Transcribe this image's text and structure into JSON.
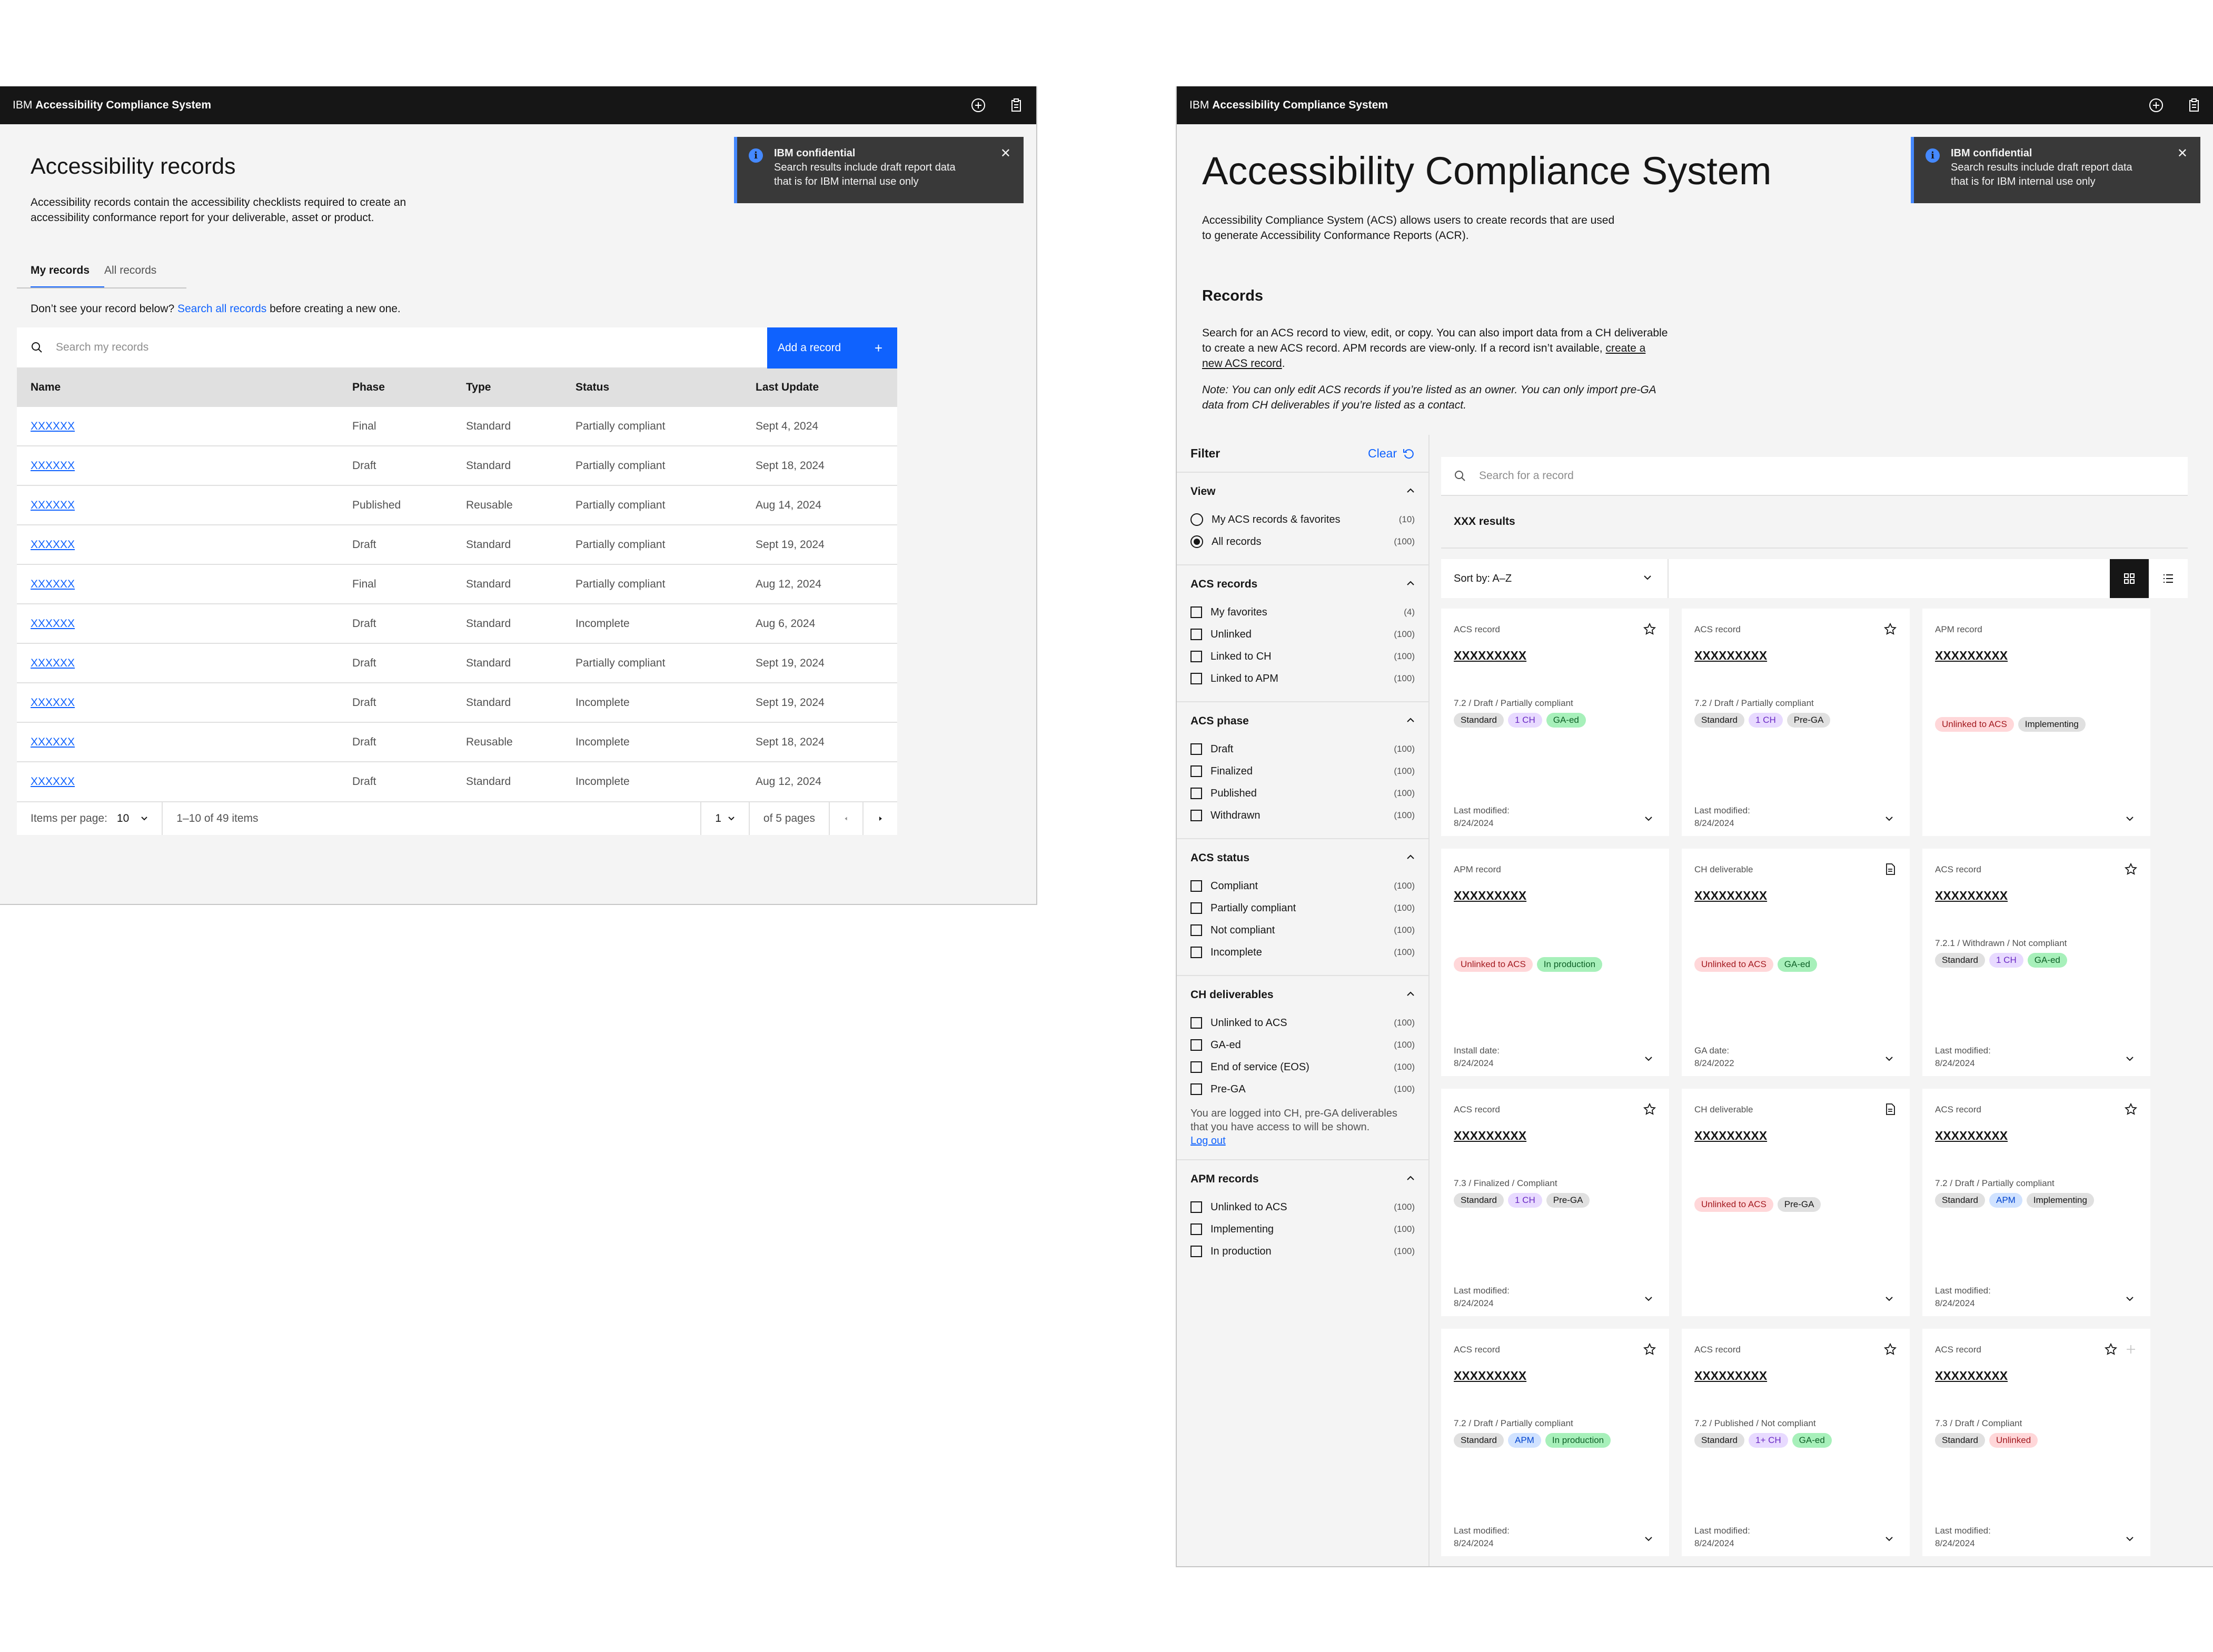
{
  "left": {
    "header": {
      "prefix": "IBM",
      "app": "Accessibility Compliance System"
    },
    "toast": {
      "title": "IBM confidential",
      "line1": "Search results include draft report data",
      "line2": "that is for IBM internal use only"
    },
    "title": "Accessibility records",
    "desc1": "Accessibility records contain the accessibility checklists required to create an",
    "desc2": "accessibility conformance report for your deliverable, asset or product.",
    "tabs": [
      "My records",
      "All records"
    ],
    "hint_pre": "Don’t see your record below?",
    "hint_link": "Search all records",
    "hint_post": "before creating a new one.",
    "search_placeholder": "Search my records",
    "add_button": "Add a record",
    "columns": [
      "Name",
      "Phase",
      "Type",
      "Status",
      "Last Update"
    ],
    "rows": [
      [
        "XXXXXX",
        "Final",
        "Standard",
        "Partially compliant",
        "Sept 4, 2024"
      ],
      [
        "XXXXXX",
        "Draft",
        "Standard",
        "Partially compliant",
        "Sept 18, 2024"
      ],
      [
        "XXXXXX",
        "Published",
        "Reusable",
        "Partially compliant",
        "Aug 14, 2024"
      ],
      [
        "XXXXXX",
        "Draft",
        "Standard",
        "Partially compliant",
        "Sept 19, 2024"
      ],
      [
        "XXXXXX",
        "Final",
        "Standard",
        "Partially compliant",
        "Aug 12, 2024"
      ],
      [
        "XXXXXX",
        "Draft",
        "Standard",
        "Incomplete",
        "Aug 6, 2024"
      ],
      [
        "XXXXXX",
        "Draft",
        "Standard",
        "Partially compliant",
        "Sept 19, 2024"
      ],
      [
        "XXXXXX",
        "Draft",
        "Standard",
        "Incomplete",
        "Sept 19, 2024"
      ],
      [
        "XXXXXX",
        "Draft",
        "Reusable",
        "Incomplete",
        "Sept 18, 2024"
      ],
      [
        "XXXXXX",
        "Draft",
        "Standard",
        "Incomplete",
        "Aug 12, 2024"
      ]
    ],
    "pager": {
      "items_label": "Items per page:",
      "items_value": "10",
      "range": "1–10 of 49 items",
      "page": "1",
      "of_pages": "of 5 pages"
    }
  },
  "right": {
    "header": {
      "prefix": "IBM",
      "app": "Accessibility Compliance System"
    },
    "toast": {
      "title": "IBM confidential",
      "line1": "Search results include draft report data",
      "line2": "that is for IBM internal use only"
    },
    "title": "Accessibility Compliance System",
    "intro1": "Accessibility Compliance System (ACS) allows users to create records that are used",
    "intro2": "to generate Accessibility Conformance Reports (ACR).",
    "records_heading": "Records",
    "rec1": "Search for an ACS record to view, edit, or copy. You can also import data from a CH deliverable",
    "rec2_pre": "to create a new ACS record. APM records are view-only. If a record isn’t available,",
    "rec2_link": "create a",
    "rec3_link": "new ACS record",
    "rec3_post": ".",
    "note1": "Note: You can only edit ACS records if you’re listed as an owner. You can only import pre-GA",
    "note2": "data from CH deliverables if you’re listed as a contact.",
    "filter": {
      "title": "Filter",
      "clear": "Clear",
      "sections": [
        {
          "title": "View",
          "kind": "radio",
          "options": [
            {
              "label": "My ACS records & favorites",
              "count": "(10)",
              "on": false
            },
            {
              "label": "All records",
              "count": "(100)",
              "on": true
            }
          ]
        },
        {
          "title": "ACS records",
          "kind": "check",
          "options": [
            {
              "label": "My favorites",
              "count": "(4)"
            },
            {
              "label": "Unlinked",
              "count": "(100)"
            },
            {
              "label": "Linked to CH",
              "count": "(100)"
            },
            {
              "label": "Linked to APM",
              "count": "(100)"
            }
          ]
        },
        {
          "title": "ACS phase",
          "kind": "check",
          "options": [
            {
              "label": "Draft",
              "count": "(100)"
            },
            {
              "label": "Finalized",
              "count": "(100)"
            },
            {
              "label": "Published",
              "count": "(100)"
            },
            {
              "label": "Withdrawn",
              "count": "(100)"
            }
          ]
        },
        {
          "title": "ACS status",
          "kind": "check",
          "options": [
            {
              "label": "Compliant",
              "count": "(100)"
            },
            {
              "label": "Partially compliant",
              "count": "(100)"
            },
            {
              "label": "Not compliant",
              "count": "(100)"
            },
            {
              "label": "Incomplete",
              "count": "(100)"
            }
          ]
        },
        {
          "title": "CH deliverables",
          "kind": "check",
          "options": [
            {
              "label": "Unlinked to ACS",
              "count": "(100)"
            },
            {
              "label": "GA-ed",
              "count": "(100)"
            },
            {
              "label": "End of service (EOS)",
              "count": "(100)"
            },
            {
              "label": "Pre-GA",
              "count": "(100)"
            }
          ],
          "note1": "You are logged into CH, pre-GA deliverables",
          "note2": "that you have access to will be shown.",
          "note_link": "Log out"
        },
        {
          "title": "APM records",
          "kind": "check",
          "options": [
            {
              "label": "Unlinked to ACS",
              "count": "(100)"
            },
            {
              "label": "Implementing",
              "count": "(100)"
            },
            {
              "label": "In production",
              "count": "(100)"
            }
          ]
        }
      ]
    },
    "search_placeholder": "Search for a record",
    "results": "XXX results",
    "sort": "Sort by: A–Z",
    "cards": [
      {
        "type": "ACS record",
        "icon": "star",
        "name": "XXXXXXXXX",
        "meta": "7.2 / Draft / Partially compliant",
        "tags": [
          [
            "Standard",
            "gray"
          ],
          [
            "1 CH",
            "purple"
          ],
          [
            "GA-ed",
            "green"
          ]
        ],
        "date_label": "Last modified:",
        "date": "8/24/2024"
      },
      {
        "type": "ACS record",
        "icon": "star",
        "name": "XXXXXXXXX",
        "meta": "7.2 / Draft / Partially compliant",
        "tags": [
          [
            "Standard",
            "gray"
          ],
          [
            "1 CH",
            "purple"
          ],
          [
            "Pre-GA",
            "gray"
          ]
        ],
        "date_label": "Last modified:",
        "date": "8/24/2024"
      },
      {
        "type": "APM record",
        "icon": "",
        "name": "XXXXXXXXX",
        "meta": "",
        "tags": [
          [
            "Unlinked to ACS",
            "red"
          ],
          [
            "Implementing",
            "gray"
          ]
        ],
        "date_label": "",
        "date": ""
      },
      {
        "type": "APM record",
        "icon": "",
        "name": "XXXXXXXXX",
        "meta": "",
        "tags": [
          [
            "Unlinked to ACS",
            "red"
          ],
          [
            "In production",
            "green"
          ]
        ],
        "date_label": "Install date:",
        "date": "8/24/2024"
      },
      {
        "type": "CH deliverable",
        "icon": "doc",
        "name": "XXXXXXXXX",
        "meta": "",
        "tags": [
          [
            "Unlinked to ACS",
            "red"
          ],
          [
            "GA-ed",
            "green"
          ]
        ],
        "date_label": "GA date:",
        "date": "8/24/2022"
      },
      {
        "type": "ACS record",
        "icon": "star",
        "name": "XXXXXXXXX",
        "meta": "7.2.1 / Withdrawn / Not compliant",
        "tags": [
          [
            "Standard",
            "gray"
          ],
          [
            "1 CH",
            "purple"
          ],
          [
            "GA-ed",
            "green"
          ]
        ],
        "date_label": "Last modified:",
        "date": "8/24/2024"
      },
      {
        "type": "ACS record",
        "icon": "star",
        "name": "XXXXXXXXX",
        "meta": "7.3 / Finalized / Compliant",
        "tags": [
          [
            "Standard",
            "gray"
          ],
          [
            "1 CH",
            "purple"
          ],
          [
            "Pre-GA",
            "gray"
          ]
        ],
        "date_label": "Last modified:",
        "date": "8/24/2024"
      },
      {
        "type": "CH deliverable",
        "icon": "doc",
        "name": "XXXXXXXXX",
        "meta": "",
        "tags": [
          [
            "Unlinked to ACS",
            "red"
          ],
          [
            "Pre-GA",
            "gray"
          ]
        ],
        "date_label": "",
        "date": ""
      },
      {
        "type": "ACS record",
        "icon": "star",
        "name": "XXXXXXXXX",
        "meta": "7.2 / Draft / Partially compliant",
        "tags": [
          [
            "Standard",
            "gray"
          ],
          [
            "APM",
            "blue"
          ],
          [
            "Implementing",
            "gray"
          ]
        ],
        "date_label": "Last modified:",
        "date": "8/24/2024"
      },
      {
        "type": "ACS record",
        "icon": "star",
        "name": "XXXXXXXXX",
        "meta": "7.2 / Draft / Partially compliant",
        "tags": [
          [
            "Standard",
            "gray"
          ],
          [
            "APM",
            "blue"
          ],
          [
            "In production",
            "green"
          ]
        ],
        "date_label": "Last modified:",
        "date": "8/24/2024"
      },
      {
        "type": "ACS record",
        "icon": "star",
        "name": "XXXXXXXXX",
        "meta": "7.2 / Published / Not compliant",
        "tags": [
          [
            "Standard",
            "gray"
          ],
          [
            "1+ CH",
            "purple"
          ],
          [
            "GA-ed",
            "green"
          ]
        ],
        "date_label": "Last modified:",
        "date": "8/24/2024"
      },
      {
        "type": "ACS record",
        "icon": "star2",
        "name": "XXXXXXXXX",
        "meta": "7.3 / Draft / Compliant",
        "tags": [
          [
            "Standard",
            "gray"
          ],
          [
            "Unlinked",
            "red"
          ]
        ],
        "date_label": "Last modified:",
        "date": "8/24/2024"
      }
    ]
  }
}
